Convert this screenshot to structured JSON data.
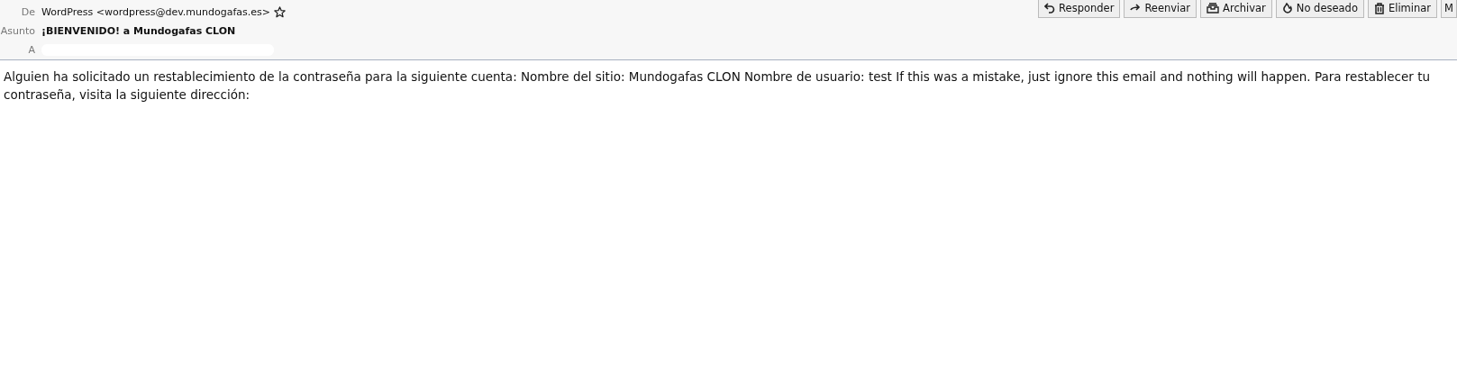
{
  "header": {
    "fields": [
      {
        "label": "De",
        "value": "WordPress <wordpress@dev.mundogafas.es>",
        "kind": "from",
        "starred": false
      },
      {
        "label": "Asunto",
        "value": "¡BIENVENIDO! a Mundogafas CLON",
        "kind": "subject"
      },
      {
        "label": "A",
        "kind": "redacted"
      }
    ],
    "buttons": [
      {
        "label": "Responder",
        "kind": "reply"
      },
      {
        "label": "Reenviar",
        "kind": "forward"
      },
      {
        "label": "Archivar",
        "kind": "archive"
      },
      {
        "label": "No deseado",
        "kind": "junk"
      },
      {
        "label": "Eliminar",
        "kind": "delete"
      },
      {
        "label": "M",
        "kind": "more"
      }
    ]
  },
  "body": {
    "text": "Alguien ha solicitado un restablecimiento de la contraseña para la siguiente cuenta: Nombre del sitio: Mundogafas CLON Nombre de usuario: test If this was a mistake, just ignore this email and nothing will happen. Para restablecer tu contraseña, visita la siguiente dirección:"
  }
}
